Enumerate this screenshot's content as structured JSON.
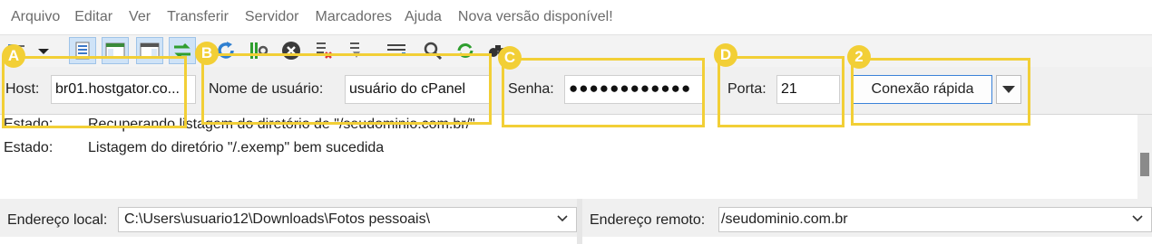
{
  "menu": [
    "Arquivo",
    "Editar",
    "Ver",
    "Transferir",
    "Servidor",
    "Marcadores",
    "Ajuda",
    "Nova versão disponível!"
  ],
  "toolbar": {
    "icons": [
      "site-manager-icon",
      "dropdown-arrow-icon",
      "message-log-icon",
      "local-tree-icon",
      "remote-tree-icon",
      "transfer-queue-icon",
      "refresh-icon",
      "process-queue-icon",
      "cancel-icon",
      "disconnect-icon",
      "reconnect-icon",
      "directory-listing-filter-icon",
      "search-icon",
      "sync-browsing-icon",
      "find-files-icon"
    ]
  },
  "quickconnect": {
    "host_label": "Host:",
    "host_value": "br01.hostgator.co...",
    "user_label": "Nome de usuário:",
    "user_value": "usuário do cPanel",
    "pass_label": "Senha:",
    "pass_value": "●●●●●●●●●●●●",
    "port_label": "Porta:",
    "port_value": "21",
    "connect_label": "Conexão rápida"
  },
  "log": [
    {
      "key": "Estado:",
      "text": "Recuperando listagem do diretório de \"/seudominio.com.br/\""
    },
    {
      "key": "Estado:",
      "text": "Listagem do diretório \"/.exemp\" bem sucedida"
    }
  ],
  "local": {
    "label": "Endereço local:",
    "path": "C:\\Users\\usuario12\\Downloads\\Fotos pessoais\\"
  },
  "remote": {
    "label": "Endereço remoto:",
    "path": "/seudominio.com.br"
  },
  "annotations": {
    "color": "#f2cf36",
    "badges": [
      "A",
      "B",
      "C",
      "D",
      "2"
    ]
  }
}
